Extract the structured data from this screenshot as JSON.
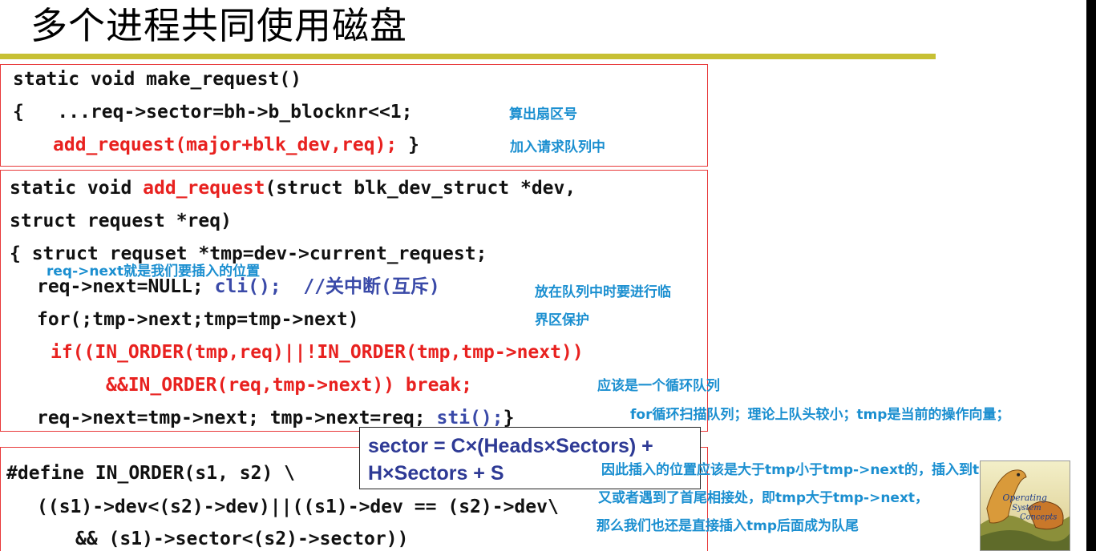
{
  "slide": {
    "title": "多个进程共同使用磁盘"
  },
  "box1": {
    "line1": "static void make_request()",
    "line2": "{   ...req->sector=bh->b_blocknr<<1;",
    "line3_red": "add_request(major+blk_dev,req);",
    "line3_tail": " }"
  },
  "box2": {
    "line1_a": "static void ",
    "line1_red": "add_request",
    "line1_b": "(struct blk_dev_struct *dev,",
    "line2": "struct request *req)",
    "line3": "{ struct requset *tmp=dev->current_request;",
    "line4_a": "req->next=NULL; ",
    "line4_blue": "cli();",
    "line4_comment": "//关中断(互斥)",
    "line5": "for(;tmp->next;tmp=tmp->next)",
    "line6_red": "if((IN_ORDER(tmp,req)||!IN_ORDER(tmp,tmp->next))",
    "line7_red": "&&IN_ORDER(req,tmp->next)) break;",
    "line8_a": "req->next=tmp->next; tmp->next=req; ",
    "line8_blue": "sti();",
    "line8_tail": "}"
  },
  "box3": {
    "line1": "#define IN_ORDER(s1, s2) \\",
    "line2": "((s1)->dev<(s2)->dev)||((s1)->dev == (s2)->dev\\",
    "line3": "&& (s1)->sector<(s2)->sector))"
  },
  "notes": {
    "sector_number": "算出扇区号",
    "add_queue": "加入请求队列中",
    "insert_pos": "req->next就是我们要插入的位置",
    "critical_1": "放在队列中时要进行临",
    "critical_2": "界区保护",
    "circular": "应该是一个循环队列",
    "for_scan": "for循环扫描队列；理论上队头较小；tmp是当前的操作向量；",
    "insert_1": "因此插入的位置应该是大于tmp小于tmp->next的，插入到tmp后面",
    "insert_2": "又或者遇到了首尾相接处，即tmp大于tmp->next，",
    "insert_3": "那么我们也还是直接插入tmp后面成为队尾"
  },
  "sector_formula": {
    "line1": "sector = C×(Heads×Sectors) +",
    "line2": "H×Sectors + S"
  },
  "book_cover": {
    "text_1": "Operating",
    "text_2": "System",
    "text_3": "Concepts"
  },
  "colors": {
    "code_red": "#e8211f",
    "note_blue": "#1b8fd0",
    "keyword_blue": "#3a4aa8",
    "rule_olive": "#c7c034",
    "box_border": "#e8393a"
  }
}
